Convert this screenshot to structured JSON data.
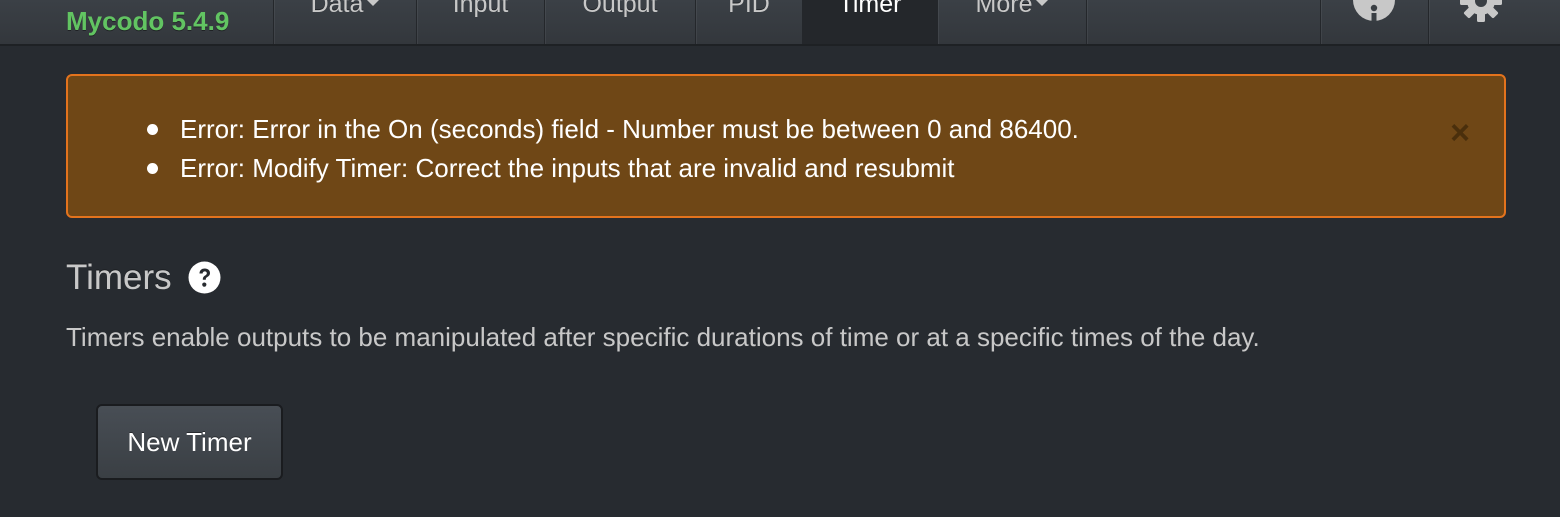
{
  "navbar": {
    "brand": "Mycodo 5.4.9",
    "items": [
      {
        "label": "Data",
        "dropdown": true
      },
      {
        "label": "Input",
        "dropdown": false
      },
      {
        "label": "Output",
        "dropdown": false
      },
      {
        "label": "PID",
        "dropdown": false
      },
      {
        "label": "Timer",
        "dropdown": false,
        "active": true
      },
      {
        "label": "More",
        "dropdown": true
      }
    ],
    "icons": [
      "info-icon",
      "gear-icon"
    ]
  },
  "alert": {
    "messages": [
      "Error: Error in the On (seconds) field - Number must be between 0 and 86400.",
      "Error: Modify Timer: Correct the inputs that are invalid and resubmit"
    ],
    "close_label": "×",
    "colors": {
      "background": "#6f4716",
      "border": "#e3731d"
    }
  },
  "page": {
    "title": "Timers",
    "description": "Timers enable outputs to be manipulated after specific durations of time or at a specific times of the day.",
    "new_button": "New Timer"
  },
  "colors": {
    "brand": "#62c462",
    "background": "#272b30",
    "navbar": "#3a3f44"
  }
}
